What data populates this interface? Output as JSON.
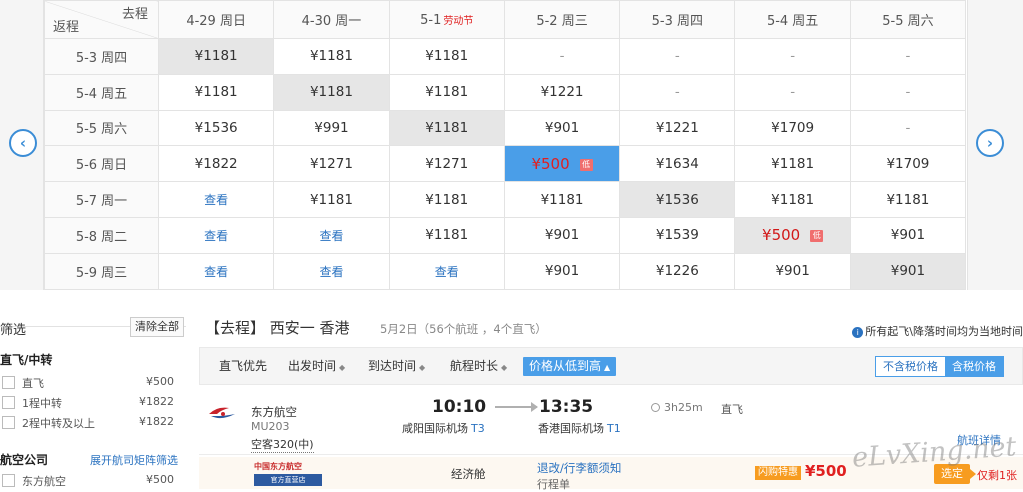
{
  "matrix": {
    "corner_depart": "去程",
    "corner_return": "返程",
    "nav_prev_icon": "chevron-left-icon",
    "nav_next_icon": "chevron-right-icon",
    "columns": [
      {
        "label": "4-29 周日",
        "holiday": ""
      },
      {
        "label": "4-30 周一",
        "holiday": ""
      },
      {
        "label": "5-1",
        "holiday": "劳动节"
      },
      {
        "label": "5-2 周三",
        "holiday": ""
      },
      {
        "label": "5-3 周四",
        "holiday": ""
      },
      {
        "label": "5-4 周五",
        "holiday": ""
      },
      {
        "label": "5-5 周六",
        "holiday": ""
      }
    ],
    "rows": [
      {
        "label": "5-3 周四",
        "cells": [
          {
            "v": "¥1181",
            "t": "gray"
          },
          {
            "v": "¥1181"
          },
          {
            "v": "¥1181"
          },
          {
            "v": "-",
            "t": "dash"
          },
          {
            "v": "-",
            "t": "dash"
          },
          {
            "v": "-",
            "t": "dash"
          },
          {
            "v": "-",
            "t": "dash"
          }
        ]
      },
      {
        "label": "5-4 周五",
        "cells": [
          {
            "v": "¥1181"
          },
          {
            "v": "¥1181",
            "t": "gray"
          },
          {
            "v": "¥1181"
          },
          {
            "v": "¥1221"
          },
          {
            "v": "-",
            "t": "dash"
          },
          {
            "v": "-",
            "t": "dash"
          },
          {
            "v": "-",
            "t": "dash"
          }
        ]
      },
      {
        "label": "5-5 周六",
        "cells": [
          {
            "v": "¥1536"
          },
          {
            "v": "¥991"
          },
          {
            "v": "¥1181",
            "t": "gray"
          },
          {
            "v": "¥901"
          },
          {
            "v": "¥1221"
          },
          {
            "v": "¥1709"
          },
          {
            "v": "-",
            "t": "dash"
          }
        ]
      },
      {
        "label": "5-6 周日",
        "cells": [
          {
            "v": "¥1822"
          },
          {
            "v": "¥1271"
          },
          {
            "v": "¥1271"
          },
          {
            "v": "¥500",
            "t": "sel",
            "tag": "低"
          },
          {
            "v": "¥1634"
          },
          {
            "v": "¥1181"
          },
          {
            "v": "¥1709"
          }
        ]
      },
      {
        "label": "5-7 周一",
        "cells": [
          {
            "v": "查看",
            "t": "look"
          },
          {
            "v": "¥1181"
          },
          {
            "v": "¥1181"
          },
          {
            "v": "¥1181"
          },
          {
            "v": "¥1536",
            "t": "gray"
          },
          {
            "v": "¥1181"
          },
          {
            "v": "¥1181"
          }
        ]
      },
      {
        "label": "5-8 周二",
        "cells": [
          {
            "v": "查看",
            "t": "look"
          },
          {
            "v": "查看",
            "t": "look"
          },
          {
            "v": "¥1181"
          },
          {
            "v": "¥901"
          },
          {
            "v": "¥1539"
          },
          {
            "v": "¥500",
            "t": "gray low",
            "tag": "低"
          },
          {
            "v": "¥901"
          }
        ]
      },
      {
        "label": "5-9 周三",
        "cells": [
          {
            "v": "查看",
            "t": "look"
          },
          {
            "v": "查看",
            "t": "look"
          },
          {
            "v": "查看",
            "t": "look"
          },
          {
            "v": "¥901"
          },
          {
            "v": "¥1226"
          },
          {
            "v": "¥901"
          },
          {
            "v": "¥901",
            "t": "gray"
          }
        ]
      }
    ]
  },
  "filter": {
    "title": "筛选",
    "clear_label": "清除全部",
    "stops_heading": "直飞/中转",
    "stops": [
      {
        "label": "直飞",
        "price": "¥500"
      },
      {
        "label": "1程中转",
        "price": "¥1822"
      },
      {
        "label": "2程中转及以上",
        "price": "¥1822"
      }
    ],
    "airline_heading": "航空公司",
    "airline_expand": "展开航司矩阵筛选",
    "airlines": [
      {
        "label": "东方航空",
        "price": "¥500"
      }
    ]
  },
  "results": {
    "route_title": "【去程】 西安一 香港",
    "route_sub": "5月2日（56个航班 ，4个直飞）",
    "tz_note": "所有起飞\\降落时间均为当地时间",
    "sort": {
      "direct_first": "直飞优先",
      "depart_time": "出发时间",
      "arrive_time": "到达时间",
      "duration": "航程时长",
      "price_asc": "价格从低到高"
    },
    "tax": {
      "exclude": "不含税价格",
      "include": "含税价格"
    },
    "flight": {
      "airline": "东方航空",
      "flight_no": "MU203",
      "aircraft": "空客320(中)",
      "dep_time": "10:10",
      "arr_time": "13:35",
      "dep_airport": "咸阳国际机场",
      "dep_terminal": "T3",
      "arr_airport": "香港国际机场",
      "arr_terminal": "T1",
      "duration": "3h25m",
      "direct": "直飞",
      "detail_link": "航班详情"
    },
    "fare": {
      "logo_top": "中国东方航空",
      "logo_bottom": "官方直营店",
      "cabin": "经济舱",
      "rules_link": "退改/行李额须知",
      "rules_sub": "行程单",
      "promo": "闪购特惠",
      "price": "¥500",
      "choose": "选定",
      "left": "仅剩1张"
    }
  },
  "watermark": "eLvXing.net",
  "colors": {
    "accent": "#4a9ee8",
    "link": "#2a72c0",
    "price_red": "#e02020",
    "orange": "#f79c20"
  }
}
